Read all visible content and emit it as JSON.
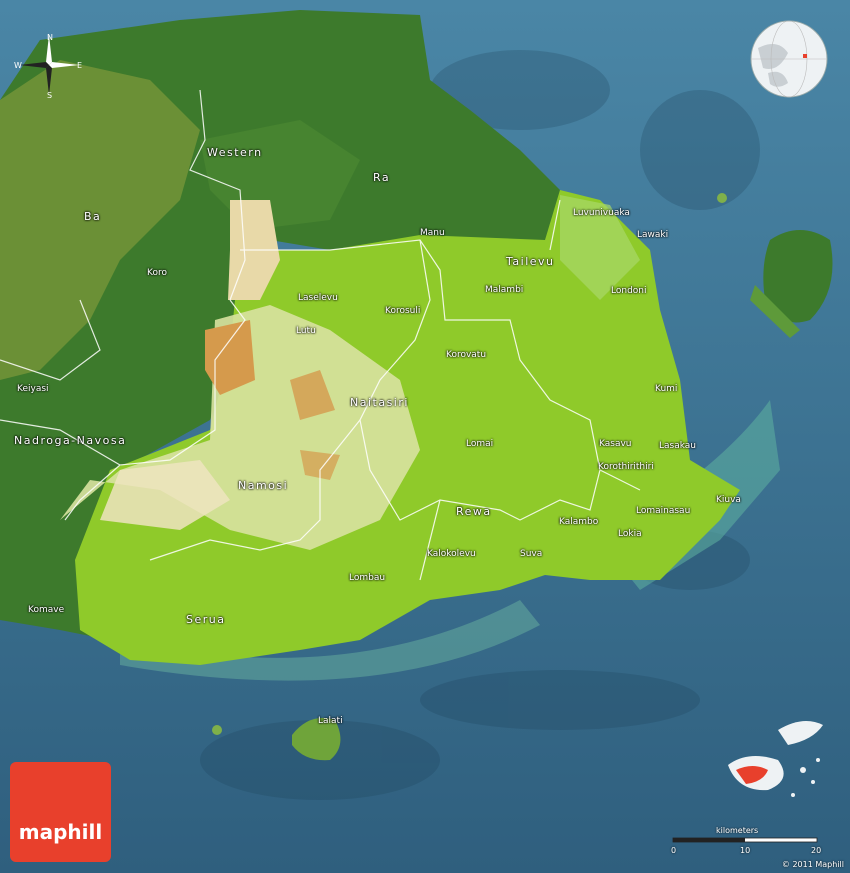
{
  "map": {
    "regions": [
      {
        "id": "western",
        "text": "Western"
      },
      {
        "id": "ra",
        "text": "Ra"
      },
      {
        "id": "ba",
        "text": "Ba"
      },
      {
        "id": "tailevu",
        "text": "Tailevu"
      },
      {
        "id": "naitasiri",
        "text": "Naitasiri"
      },
      {
        "id": "namosi",
        "text": "Namosi"
      },
      {
        "id": "rewa",
        "text": "Rewa"
      },
      {
        "id": "serua",
        "text": "Serua"
      },
      {
        "id": "nadroga",
        "text": "Nadroga-Navosa"
      }
    ],
    "places": [
      {
        "id": "luvunivuaka",
        "text": "Luvunivuaka"
      },
      {
        "id": "lawaki",
        "text": "Lawaki"
      },
      {
        "id": "manu",
        "text": "Manu"
      },
      {
        "id": "londoni",
        "text": "Londoni"
      },
      {
        "id": "malambi",
        "text": "Malambi"
      },
      {
        "id": "koro",
        "text": "Koro"
      },
      {
        "id": "laselevu",
        "text": "Laselevu"
      },
      {
        "id": "korosuli",
        "text": "Korosuli"
      },
      {
        "id": "lutu",
        "text": "Lutu"
      },
      {
        "id": "korovatu",
        "text": "Korovatu"
      },
      {
        "id": "kumi",
        "text": "Kumi"
      },
      {
        "id": "keiyasi",
        "text": "Keiyasi"
      },
      {
        "id": "lomai",
        "text": "Lomai"
      },
      {
        "id": "kasavu",
        "text": "Kasavu"
      },
      {
        "id": "lasakau",
        "text": "Lasakau"
      },
      {
        "id": "korothirithiri",
        "text": "Korothirithiri"
      },
      {
        "id": "kiuva",
        "text": "Kiuva"
      },
      {
        "id": "lomainasau",
        "text": "Lomainasau"
      },
      {
        "id": "kalambo",
        "text": "Kalambo"
      },
      {
        "id": "lokia",
        "text": "Lokia"
      },
      {
        "id": "kalokolevu",
        "text": "Kalokolevu"
      },
      {
        "id": "suva",
        "text": "Suva"
      },
      {
        "id": "lombau",
        "text": "Lombau"
      },
      {
        "id": "komave",
        "text": "Komave"
      },
      {
        "id": "lalati",
        "text": "Lalati"
      }
    ],
    "compass": {
      "n": "N",
      "s": "S",
      "e": "E",
      "w": "W"
    },
    "scale": {
      "title": "kilometers",
      "ticks": [
        "0",
        "10",
        "20"
      ]
    },
    "logo": "maphill",
    "copyright": "© 2011 Maphill",
    "colors": {
      "ocean": "#3f6f8f",
      "lowland": "#8fca2a",
      "forest": "#3d7a2c",
      "highland": "#e8d9a8",
      "peak": "#d59a4c",
      "border": "#ffffff",
      "brand": "#e8402c"
    }
  }
}
